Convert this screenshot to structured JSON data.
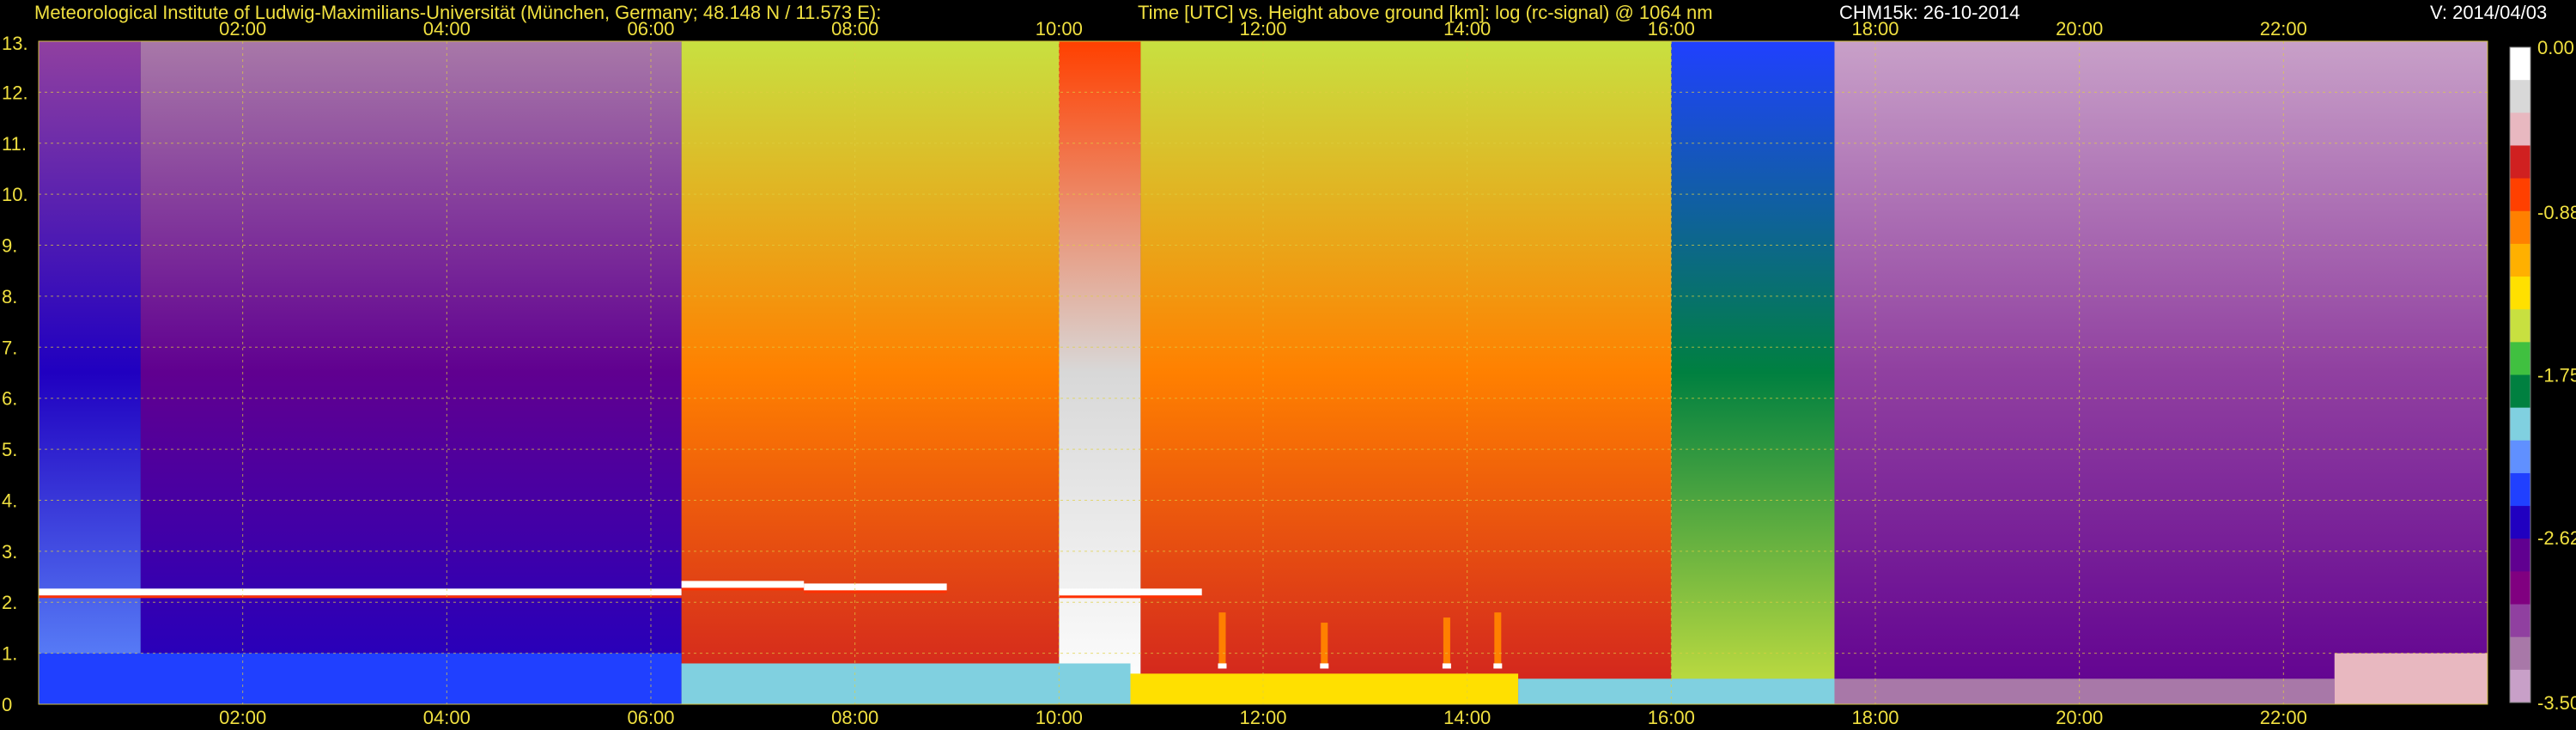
{
  "header": {
    "institute": "Meteorological Institute of Ludwig-Maximilians-Universität (München, Germany; 48.148 N / 11.573 E):",
    "description": "Time [UTC] vs. Height above ground [km]: log (rc-signal) @ 1064 nm",
    "instrument": "CHM15k: 26-10-2014",
    "version": "V: 2014/04/03"
  },
  "chart_data": {
    "type": "heatmap",
    "title": "Time [UTC] vs. Height above ground [km]: log (rc-signal) @ 1064 nm",
    "xlabel": "",
    "ylabel": "",
    "x_unit": "hours UTC",
    "xlim": [
      0,
      24
    ],
    "ylim": [
      0,
      13
    ],
    "x_ticks": [
      2,
      4,
      6,
      8,
      10,
      12,
      14,
      16,
      18,
      20,
      22
    ],
    "x_tick_labels": [
      "02:00",
      "04:00",
      "06:00",
      "08:00",
      "10:00",
      "12:00",
      "14:00",
      "16:00",
      "18:00",
      "20:00",
      "22:00"
    ],
    "y_ticks": [
      0,
      1,
      2,
      3,
      4,
      5,
      6,
      7,
      8,
      9,
      10,
      11,
      12,
      13
    ],
    "y_tick_labels": [
      "0",
      "1.",
      "2.",
      "3.",
      "4.",
      "5.",
      "6.",
      "7.",
      "8.",
      "9.",
      "10.",
      "11.",
      "12.",
      "13."
    ],
    "grid": true,
    "colorbar": {
      "range": [
        -3.5,
        0.0
      ],
      "tick_values": [
        0.0,
        -0.88,
        -1.75,
        -2.62,
        -3.5
      ],
      "tick_labels": [
        "0.00",
        "-0.88",
        "-1.75",
        "-2.62",
        "-3.50"
      ],
      "colors": [
        "#ffffff",
        "#d8d8d8",
        "#e8b8c0",
        "#d02020",
        "#ff4000",
        "#ff8000",
        "#ffb000",
        "#ffe000",
        "#c8e040",
        "#40c040",
        "#008040",
        "#80d0e0",
        "#6090ff",
        "#2040ff",
        "#2000c0",
        "#600090",
        "#800080",
        "#9040a0",
        "#a878a8",
        "#c8a0c8"
      ]
    },
    "upper_signal_bands": [
      {
        "start": 0.0,
        "end": 1.0,
        "value": -2.45
      },
      {
        "start": 1.0,
        "end": 6.3,
        "value": -2.75
      },
      {
        "start": 6.3,
        "end": 10.0,
        "value": -1.0
      },
      {
        "start": 10.0,
        "end": 10.8,
        "value": -0.2
      },
      {
        "start": 10.8,
        "end": 16.0,
        "value": -0.95
      },
      {
        "start": 16.0,
        "end": 17.6,
        "value": -1.85
      },
      {
        "start": 17.6,
        "end": 24.0,
        "value": -3.05
      }
    ],
    "boundary_layer_top_km": [
      {
        "start": 0.0,
        "end": 6.3,
        "height": 2.2
      },
      {
        "start": 6.3,
        "end": 7.5,
        "height": 2.35
      },
      {
        "start": 7.5,
        "end": 8.9,
        "height": 2.3
      },
      {
        "start": 10.0,
        "end": 11.4,
        "height": 2.2
      }
    ],
    "surface_layer": [
      {
        "start": 0.0,
        "end": 6.3,
        "top": 1.0,
        "value": -2.35
      },
      {
        "start": 6.3,
        "end": 10.7,
        "top": 0.8,
        "value": -2.0
      },
      {
        "start": 10.7,
        "end": 14.5,
        "top": 0.6,
        "value": -1.4
      },
      {
        "start": 14.5,
        "end": 17.6,
        "top": 0.5,
        "value": -2.0
      },
      {
        "start": 17.6,
        "end": 22.5,
        "top": 0.5,
        "value": -3.2
      },
      {
        "start": 22.5,
        "end": 24.0,
        "top": 1.0,
        "value": -0.5
      }
    ],
    "low_cloud_echoes": [
      {
        "time": 11.6,
        "base": 0.7,
        "top": 1.8
      },
      {
        "time": 12.6,
        "base": 0.7,
        "top": 1.6
      },
      {
        "time": 13.8,
        "base": 0.7,
        "top": 1.7
      },
      {
        "time": 14.3,
        "base": 0.7,
        "top": 1.8
      }
    ]
  }
}
